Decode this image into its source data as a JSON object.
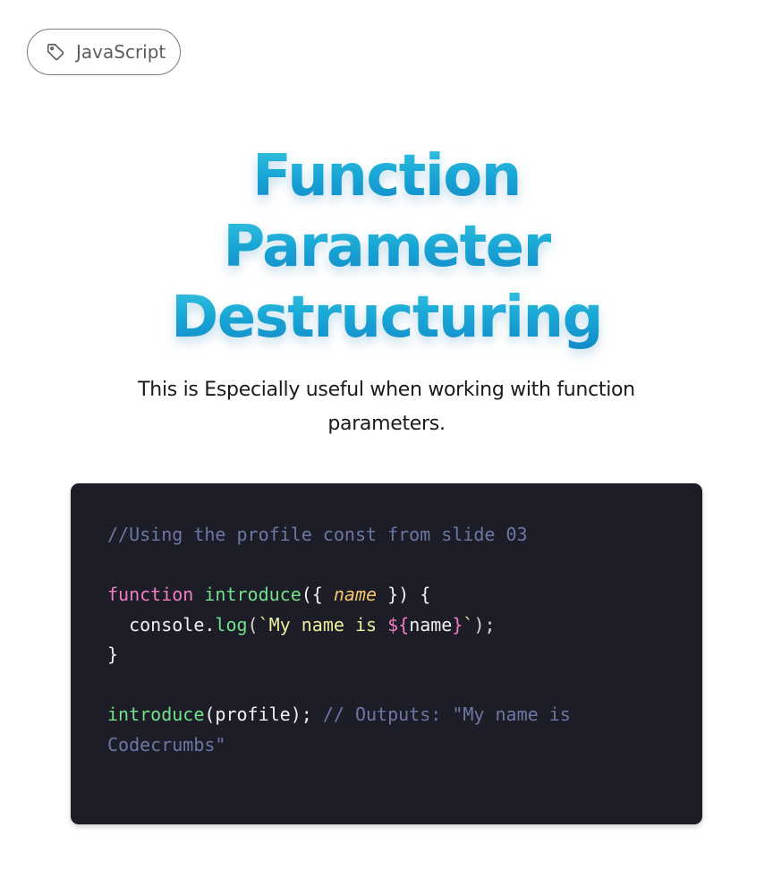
{
  "tag": {
    "label": "JavaScript",
    "icon": "tag-icon"
  },
  "title": {
    "lines": [
      "Function",
      "Parameter",
      "Destructuring"
    ]
  },
  "subtitle": {
    "lines": [
      "This is Especially useful when working with function",
      "parameters."
    ]
  },
  "code": {
    "comment_line": "//Using the profile const from slide 03",
    "fn_keyword": "function",
    "fn_name": "introduce",
    "fn_open": "({ ",
    "fn_param": "name",
    "fn_close": " }) {",
    "body_indent": "  ",
    "body_object": "console.",
    "body_method": "log",
    "body_paren_open": "(",
    "body_str_start": "`My name is ",
    "body_interp_open": "${",
    "body_interp_var": "name",
    "body_interp_close": "}",
    "body_str_end": "`",
    "body_paren_close": ");",
    "close_brace": "}",
    "call_name": "introduce",
    "call_args": "(profile); ",
    "call_comment_1": "// Outputs: \"My name is",
    "call_comment_2": "Codecrumbs\""
  },
  "colors": {
    "title_gradient_top": "#3ac5df",
    "title_gradient_bottom": "#1186c7",
    "code_background": "#1c1d26",
    "keyword": "#f17cc4",
    "function": "#72e08c",
    "comment": "#6d77a6",
    "param": "#f7c86b"
  }
}
